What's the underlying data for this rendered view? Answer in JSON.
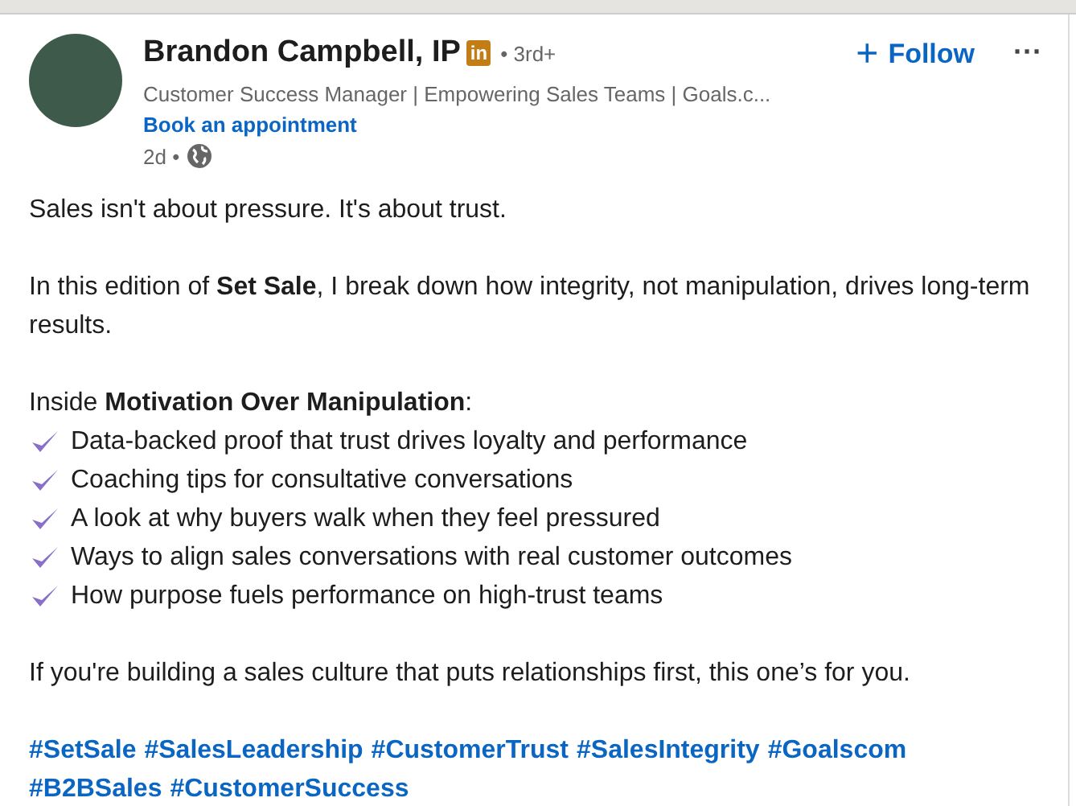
{
  "author": {
    "name": "Brandon Campbell, IP",
    "badge": "in",
    "degree": "• 3rd+",
    "headline": "Customer Success Manager | Empowering Sales Teams | Goals.c...",
    "link": "Book an appointment",
    "time": "2d •"
  },
  "actions": {
    "follow": "Follow",
    "follow_icon": "+",
    "more": "···"
  },
  "paragraphs": [
    "Sales isn't about pressure. It's about trust.",
    "In this edition of **Set Sale**, I break down how integrity, not manipulation, drives long-term results.",
    "Inside **Motivation Over Manipulation**:"
  ],
  "bullets": [
    "Data-backed proof that trust drives loyalty and performance",
    "Coaching tips for consultative conversations",
    "A look at why buyers walk when they feel pressured",
    "Ways to align sales conversations with real customer outcomes",
    "How purpose fuels performance on high-trust teams"
  ],
  "closing": "If you're building a sales culture that puts relationships first, this one’s for you.",
  "hashtags": [
    "#SetSale",
    "#SalesLeadership",
    "#CustomerTrust",
    "#SalesIntegrity",
    "#Goalscom",
    "#B2BSales",
    "#CustomerSuccess"
  ]
}
